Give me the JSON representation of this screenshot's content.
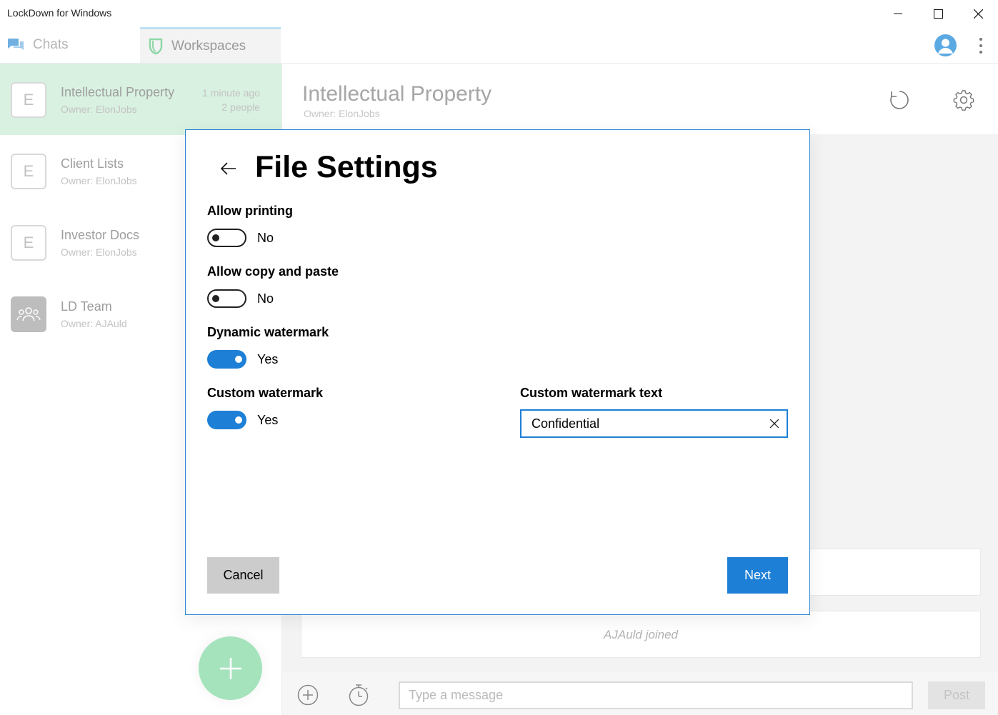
{
  "window": {
    "title": "LockDown for Windows",
    "controls": [
      "minimize",
      "maximize",
      "close"
    ]
  },
  "tabs": {
    "chats": "Chats",
    "workspaces": "Workspaces",
    "active": "workspaces"
  },
  "sidebar": {
    "items": [
      {
        "badge": "E",
        "name": "Intellectual Property",
        "owner": "Owner:  ElonJobs",
        "time": "1 minute ago",
        "people": "2 people",
        "active": true
      },
      {
        "badge": "E",
        "name": "Client Lists",
        "owner": "Owner:  ElonJobs"
      },
      {
        "badge": "E",
        "name": "Investor Docs",
        "owner": "Owner:  ElonJobs"
      },
      {
        "badge": "",
        "icon": "group-icon",
        "name": "LD Team",
        "owner": "Owner:  AJAuld"
      }
    ],
    "fab_icon": "plus-icon"
  },
  "main": {
    "title": "Intellectual Property",
    "owner": "Owner:  ElonJobs",
    "messages": [
      {
        "text": ""
      },
      {
        "text": "AJAuld joined"
      }
    ],
    "composer": {
      "placeholder": "Type a message",
      "post_label": "Post"
    }
  },
  "dialog": {
    "title": "File Settings",
    "settings": [
      {
        "label": "Allow printing",
        "state": "No",
        "on": false
      },
      {
        "label": "Allow copy and paste",
        "state": "No",
        "on": false
      },
      {
        "label": "Dynamic watermark",
        "state": "Yes",
        "on": true
      },
      {
        "label": "Custom watermark",
        "state": "Yes",
        "on": true
      }
    ],
    "watermark_text_label": "Custom watermark text",
    "watermark_text_value": "Confidential",
    "cancel_label": "Cancel",
    "next_label": "Next"
  },
  "colors": {
    "accent": "#1e7fd6",
    "active_item": "#d9f1e1",
    "fab": "#a5e3bd",
    "cancel": "#cccccc"
  }
}
